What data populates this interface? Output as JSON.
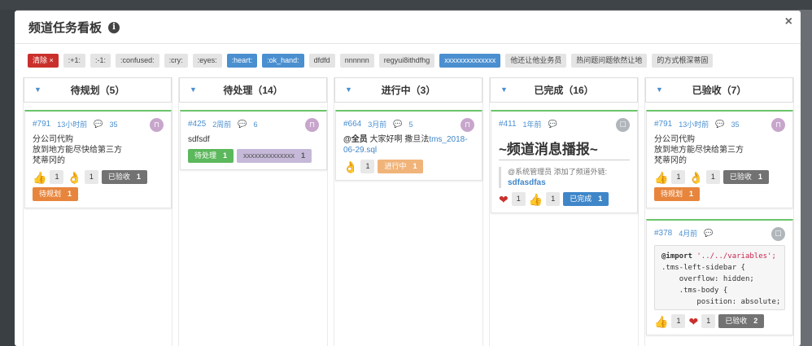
{
  "modal": {
    "title": "频道任务看板",
    "info_icon": "i",
    "close_icon": "×"
  },
  "tags": [
    {
      "label": "清除 ×",
      "style": "clear"
    },
    {
      "label": ":+1:",
      "style": "gray"
    },
    {
      "label": ":-1:",
      "style": "gray"
    },
    {
      "label": ":confused:",
      "style": "gray"
    },
    {
      "label": ":cry:",
      "style": "gray"
    },
    {
      "label": ":eyes:",
      "style": "gray"
    },
    {
      "label": ":heart:",
      "style": "blue"
    },
    {
      "label": ":ok_hand:",
      "style": "blue"
    },
    {
      "label": "dfdfd",
      "style": "gray"
    },
    {
      "label": "nnnnnn",
      "style": "gray"
    },
    {
      "label": "regyui8ithdfhg",
      "style": "gray"
    },
    {
      "label": "xxxxxxxxxxxxxx",
      "style": "blue"
    },
    {
      "label": "他还让他业务员",
      "style": "gray"
    },
    {
      "label": "热问题问题依然让地",
      "style": "gray"
    },
    {
      "label": "的方式根深蒂固",
      "style": "gray"
    }
  ],
  "columns": [
    {
      "title": "待规划（5）"
    },
    {
      "title": "待处理（14）"
    },
    {
      "title": "进行中（3）"
    },
    {
      "title": "已完成（16）"
    },
    {
      "title": "已验收（7）"
    }
  ],
  "cards": {
    "c1": {
      "id": "#791",
      "time": "13小时前",
      "comments": "35",
      "avatar": "⊓",
      "lines": [
        "分公司代购",
        "放到地方能尽快给第三方",
        "梵蒂冈的"
      ],
      "r1": "1",
      "r2": "1",
      "status": "已验收",
      "status_n": "1",
      "status2": "待规划",
      "status2_n": "1"
    },
    "c2": {
      "id": "#425",
      "time": "2周前",
      "comments": "6",
      "avatar": "⊓",
      "text": "sdfsdf",
      "status": "待处理",
      "status_n": "1",
      "tag": "xxxxxxxxxxxxxx",
      "tag_n": "1"
    },
    "c3": {
      "id": "#664",
      "time": "3月前",
      "comments": "5",
      "avatar": "⊓",
      "mention": "@全员",
      "text": "大家好啊 撒旦法",
      "link": "tms_2018-06-29.sql",
      "r1": "1",
      "status": "进行中",
      "status_n": "1"
    },
    "c4": {
      "id": "#411",
      "time": "1年前",
      "comments": "",
      "avatar": "☐",
      "big": "~频道消息播报~",
      "q_user": "@系统管理员",
      "q_text": "添加了频道外链:",
      "q_link": "sdfasdfas",
      "r1": "1",
      "r2": "1",
      "status": "已完成",
      "status_n": "1"
    },
    "c5": {
      "id": "#791",
      "time": "13小时前",
      "comments": "35",
      "avatar": "⊓",
      "lines": [
        "分公司代购",
        "放到地方能尽快给第三方",
        "梵蒂冈的"
      ],
      "r1": "1",
      "r2": "1",
      "status": "已验收",
      "status_n": "1",
      "status2": "待规划",
      "status2_n": "1"
    },
    "c6": {
      "id": "#378",
      "time": "4月前",
      "comments": "",
      "avatar": "☐",
      "code1": "@import",
      "code1s": "'../../variables';",
      "code2": ".tms-left-sidebar {",
      "code3": "overflow: hidden;",
      "code4": ".tms-body {",
      "code5": "position: absolute;",
      "r1": "1",
      "r2": "1",
      "status": "已验收",
      "status_n": "2"
    }
  }
}
